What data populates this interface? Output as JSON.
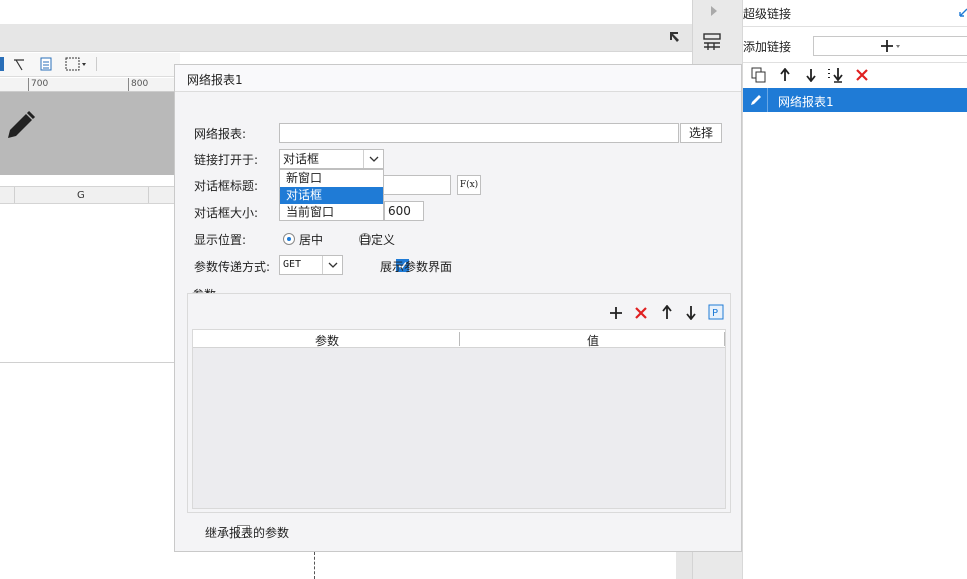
{
  "background": {
    "ruler_ticks": [
      "700",
      "800"
    ],
    "column_header": "G"
  },
  "right_panel": {
    "title": "超级链接",
    "add_link_label": "添加链接",
    "add_link_button": "+",
    "links": [
      "网络报表1"
    ]
  },
  "dialog": {
    "title": "网络报表1",
    "report_label": "网络报表:",
    "report_value": "",
    "select_button": "选择",
    "open_in_label": "链接打开于:",
    "open_in_value": "对话框",
    "open_in_options": [
      "新窗口",
      "对话框",
      "当前窗口"
    ],
    "dialog_title_label": "对话框标题:",
    "formula_button": "F(x)",
    "dialog_size_label": "对话框大小:",
    "dialog_size_value": "600",
    "position_label": "显示位置:",
    "position_center": "居中",
    "position_custom": "自定义",
    "param_method_label": "参数传递方式:",
    "param_method_value": "GET",
    "show_param_ui_label": "展示参数界面",
    "params_group_label": "参数",
    "params_columns": [
      "参数",
      "值"
    ],
    "inherit_params_label": "继承报表的参数"
  },
  "colors": {
    "accent": "#1f7bd6",
    "delete_red": "#e02020"
  }
}
